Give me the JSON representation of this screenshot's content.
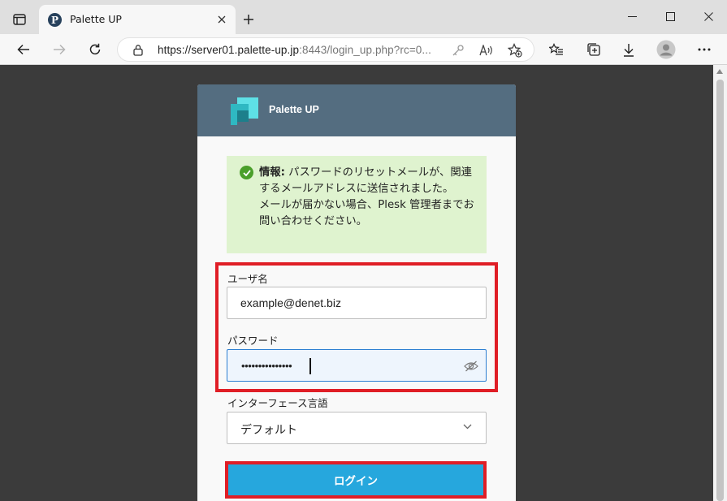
{
  "browser": {
    "tab_title": "Palette UP",
    "favicon_letter": "P",
    "url_host": "https://server01.palette-up.jp",
    "url_rest": ":8443/login_up.php?rc=0..."
  },
  "card": {
    "brand": "Palette UP",
    "info": {
      "title": "情報:",
      "line1": "パスワードのリセットメールが、関連するメールアドレスに送信されました。",
      "line2": "メールが届かない場合、Plesk 管理者までお問い合わせください。"
    },
    "username": {
      "label": "ユーザ名",
      "value": "example@denet.biz"
    },
    "password": {
      "label": "パスワード",
      "masked": "•••••••••••••••"
    },
    "language": {
      "label": "インターフェース言語",
      "selected": "デフォルト"
    },
    "login_label": "ログイン"
  },
  "colors": {
    "header_bg": "#546d80",
    "info_bg": "#dff3cf",
    "highlight": "#e01e26",
    "login_button": "#26a7dd",
    "page_bg": "#3b3b3b"
  },
  "icons": {
    "tab_actions": "tab-actions-icon",
    "back": "back-arrow-icon",
    "forward": "forward-arrow-icon",
    "refresh": "refresh-icon",
    "lock": "lock-icon",
    "key": "key-icon",
    "read_aloud": "read-aloud-icon",
    "add_favorite": "add-favorite-icon",
    "favorites": "favorites-icon",
    "collections": "collections-icon",
    "downloads": "download-icon",
    "profile": "profile-avatar-icon",
    "info": "check-circle-icon",
    "show_password": "eye-slash-icon",
    "dropdown": "chevron-down-icon"
  }
}
